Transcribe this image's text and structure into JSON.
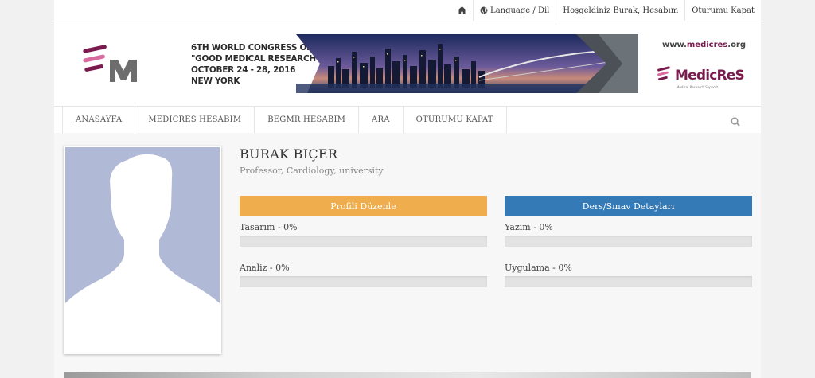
{
  "topbar": {
    "home_icon": "home-icon",
    "language_icon": "globe-icon",
    "language_label": "Language / Dil",
    "welcome_label": "Hoşgeldiniz Burak, Hesabım",
    "logout_label": "Oturumu Kapat"
  },
  "banner": {
    "line1": "6TH WORLD CONGRESS  ON",
    "line2": "\"GOOD MEDICAL RESEARCH\"",
    "line3": "OCTOBER 24 - 28, 2016",
    "line4": "NEW YORK",
    "site_prefix": "www.",
    "site_brand": "medicres",
    "site_suffix": ".org",
    "brand_name": "MedicReS",
    "brand_sub": "Medical Research Support"
  },
  "nav": {
    "items": [
      {
        "label": "ANASAYFA"
      },
      {
        "label": "MEDICRES HESABIM"
      },
      {
        "label": "BEGMR HESABIM"
      },
      {
        "label": "ARA"
      },
      {
        "label": "OTURUMU KAPAT"
      }
    ],
    "search_icon": "search-icon"
  },
  "profile": {
    "name": "BURAK BIÇER",
    "title": "Professor, Cardiology, university",
    "edit_button": "Profili Düzenle",
    "details_button": "Ders/Sınav Detayları",
    "skills": [
      {
        "label": "Tasarım - 0%",
        "progress": 0
      },
      {
        "label": "Yazım - 0%",
        "progress": 0
      },
      {
        "label": "Analiz - 0%",
        "progress": 0
      },
      {
        "label": "Uygulama - 0%",
        "progress": 0
      }
    ]
  },
  "colors": {
    "edit_button": "#f0ad4e",
    "details_button": "#337ab7",
    "brand": "#7a1b4f",
    "avatar_bg": "#b0b9d6"
  }
}
